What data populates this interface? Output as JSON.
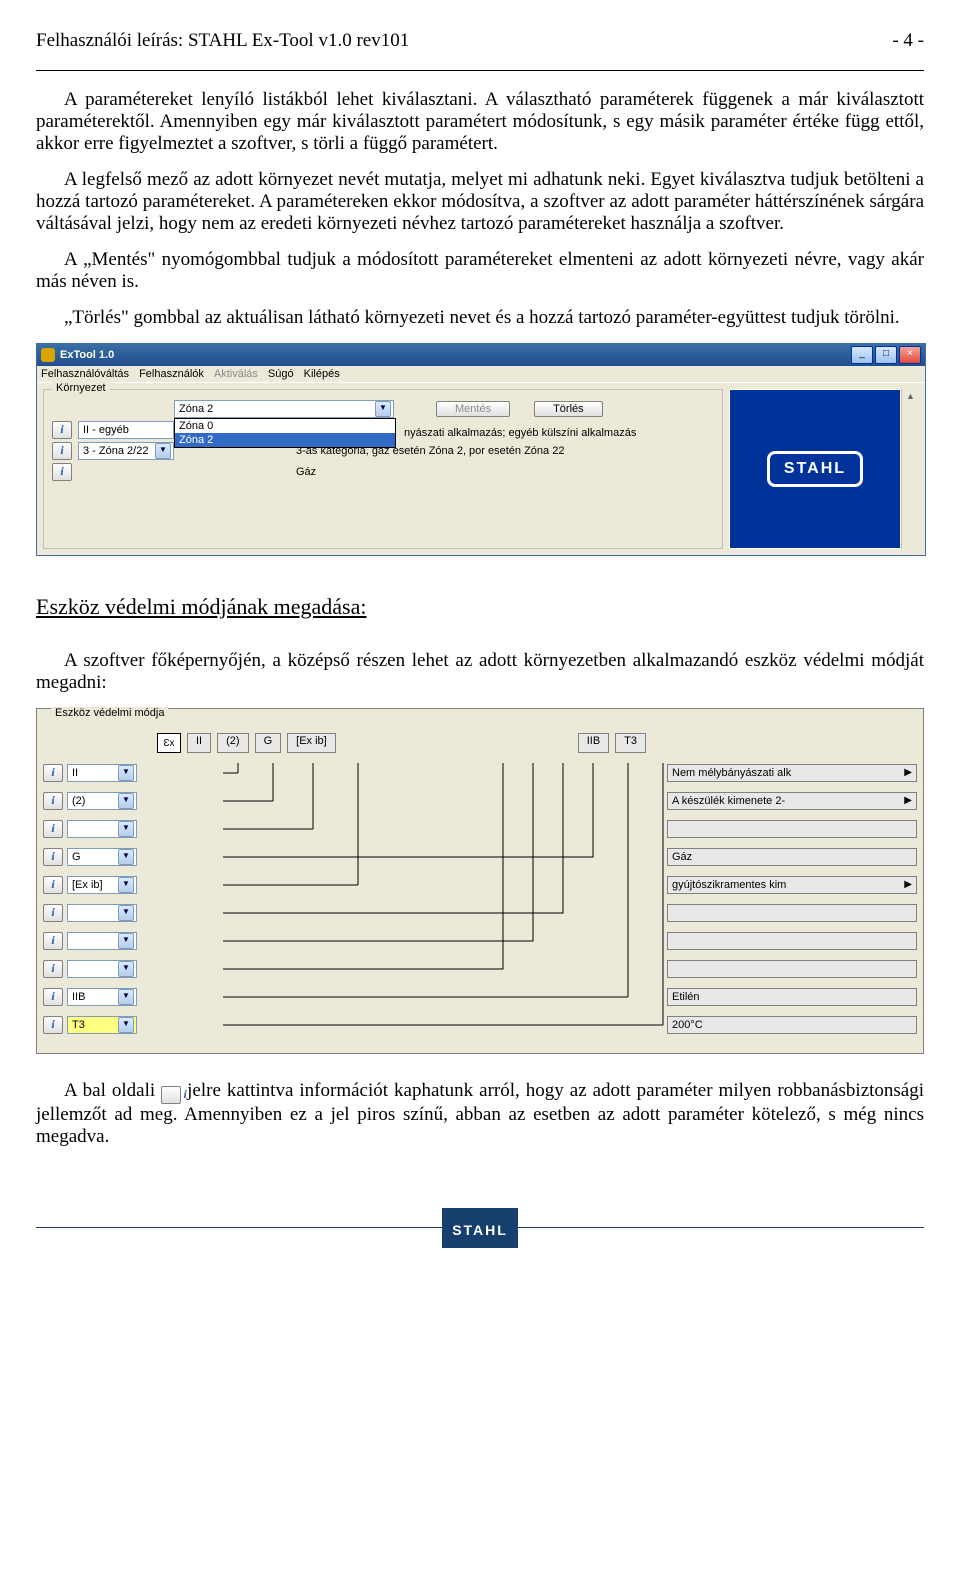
{
  "header": {
    "left": "Felhasználói leírás: STAHL Ex-Tool v1.0 rev101",
    "right": "- 4 -"
  },
  "paragraphs": {
    "p1": "A paramétereket lenyíló listákból lehet kiválasztani. A választható paraméterek függenek a már kiválasztott paraméterektől. Amennyiben egy már kiválasztott paramétert módosítunk, s egy másik paraméter értéke függ ettől, akkor erre figyelmeztet a szoftver, s törli a függő paramétert.",
    "p2": "A legfelső mező az adott környezet nevét mutatja, melyet mi adhatunk neki. Egyet kiválasztva tudjuk betölteni a hozzá tartozó paramétereket. A paramétereken ekkor módosítva, a szoftver az adott paraméter háttérszínének sárgára váltásával jelzi, hogy nem az eredeti környezeti névhez tartozó paramétereket használja a szoftver.",
    "p3": "A „Mentés\" nyomógombbal tudjuk a módosított paramétereket elmenteni az adott környezeti névre, vagy akár más néven is.",
    "p4": "„Törlés\" gombbal az aktuálisan látható környezeti nevet és a hozzá tartozó paraméter-együttest tudjuk törölni.",
    "sec2": "Eszköz védelmi módjának megadása:",
    "p5": "A szoftver főképernyőjén, a középső részen lehet az adott környezetben alkalmazandó eszköz védelmi módját megadni:",
    "p6a": "A bal oldali ",
    "p6b": " jelre kattintva információt kaphatunk arról, hogy az adott paraméter milyen robbanásbiztonsági jellemzőt ad meg. Amennyiben ez a jel piros színű, abban az esetben az adott paraméter kötelező, s még nincs megadva."
  },
  "win1": {
    "title": "ExTool 1.0",
    "menu": {
      "m1": "Felhasználóváltás",
      "m2": "Felhasználók",
      "m3": "Aktiválás",
      "m4": "Súgó",
      "m5": "Kilépés"
    },
    "group_label": "Környezet",
    "main_value": "Zóna 2",
    "dd": {
      "opt1": "Zóna 0",
      "opt2": "Zóna 2"
    },
    "btn_save": "Mentés",
    "btn_del": "Törlés",
    "row2_val": "II - egyéb",
    "row2_desc": "nyászati alkalmazás; egyéb külszíni alkalmazás",
    "row3_val": "3 - Zóna 2/22",
    "row3_desc": "3-as kategória, gáz esetén Zóna 2, por esetén Zóna 22",
    "row4_desc": "Gáz",
    "logo": "STAHL"
  },
  "win2": {
    "group_label": "Eszköz védelmi módja",
    "chips": [
      "II",
      "(2)",
      "G",
      "[Ex ib]",
      "IIB",
      "T3"
    ],
    "rows": [
      {
        "val": "II",
        "desc": "Nem mélybányászati alk",
        "yellow": false,
        "arrow": true
      },
      {
        "val": "(2)",
        "desc": "A készülék kimenete 2-",
        "yellow": false,
        "arrow": true
      },
      {
        "val": "",
        "desc": "",
        "yellow": false,
        "arrow": false
      },
      {
        "val": "G",
        "desc": "Gáz",
        "yellow": false,
        "arrow": false
      },
      {
        "val": "[Ex ib]",
        "desc": "gyújtószikramentes kim",
        "yellow": false,
        "arrow": true
      },
      {
        "val": "",
        "desc": "",
        "yellow": false,
        "arrow": false
      },
      {
        "val": "",
        "desc": "",
        "yellow": false,
        "arrow": false
      },
      {
        "val": "",
        "desc": "",
        "yellow": false,
        "arrow": false
      },
      {
        "val": "IIB",
        "desc": "Etilén",
        "yellow": false,
        "arrow": false
      },
      {
        "val": "T3",
        "desc": "200°C",
        "yellow": true,
        "arrow": false
      }
    ]
  },
  "footer": {
    "logo": "STAHL"
  }
}
